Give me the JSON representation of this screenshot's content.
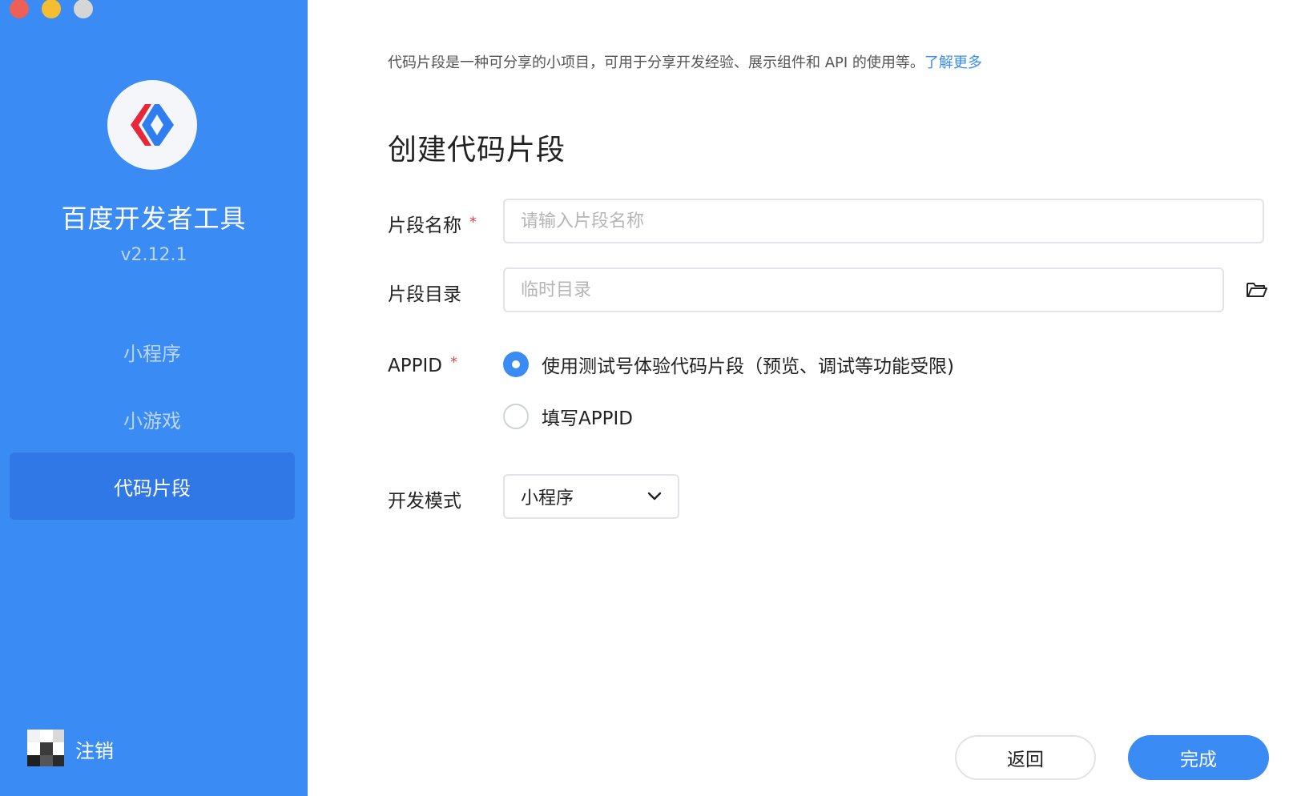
{
  "sidebar": {
    "app_title": "百度开发者工具",
    "version": "v2.12.1",
    "nav": [
      {
        "label": "小程序"
      },
      {
        "label": "小游戏"
      },
      {
        "label": "代码片段"
      }
    ],
    "logout_label": "注销",
    "accent_color": "#3a8bf4"
  },
  "main": {
    "intro_text": "代码片段是一种可分享的小项目，可用于分享开发经验、展示组件和 API 的使用等。",
    "intro_link": "了解更多",
    "heading": "创建代码片段",
    "form": {
      "name_label": "片段名称",
      "name_placeholder": "请输入片段名称",
      "required_mark": "*",
      "dir_label": "片段目录",
      "dir_placeholder": "临时目录",
      "appid_label": "APPID",
      "appid_options": [
        {
          "label": "使用测试号体验代码片段（预览、调试等功能受限)",
          "selected": true
        },
        {
          "label": "填写APPID",
          "selected": false
        }
      ],
      "mode_label": "开发模式",
      "mode_value": "小程序"
    },
    "buttons": {
      "back": "返回",
      "done": "完成"
    }
  }
}
